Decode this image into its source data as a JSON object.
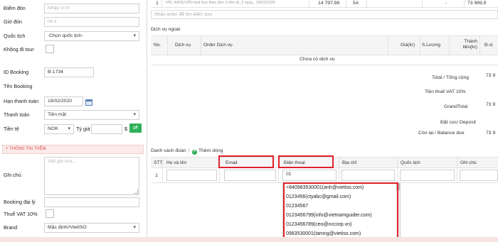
{
  "form": {
    "diem_don": {
      "label": "Điểm đón",
      "placeholder": "Nhập vị trí"
    },
    "gio_don": {
      "label": "Giờ đón",
      "placeholder": "hh:ii"
    },
    "quoc_tich": {
      "label": "Quốc tịch",
      "value": "-Chọn quốc tịch-"
    },
    "khong_di_tour": {
      "label": "Không đi tour"
    },
    "id_booking": {
      "label": "ID Booking",
      "value": "B-1734"
    },
    "ten_booking": {
      "label": "Tên Booking"
    },
    "han_thanh_toan": {
      "label": "Hạn thanh toán",
      "value": "19/02/2020"
    },
    "thanh_toan": {
      "label": "Thanh toán",
      "value": "Tiền mặt"
    },
    "tien_te": {
      "label": "Tiền tệ",
      "value": "NOK",
      "ty_gia_label": "Tỷ giá",
      "currency_symbol": "$"
    },
    "section_more": "+ THÔNG TIN THÊM",
    "ghi_chu": {
      "label": "Ghi chú",
      "placeholder": "Viết ghi chú..."
    },
    "booking_dai_ly": {
      "label": "Booking đại lý"
    },
    "thue_vat": {
      "label": "Thuế VAT 10%"
    },
    "brand": {
      "label": "Brand",
      "value": "Mặc định//VietISO"
    }
  },
  "tour_row": {
    "num": "1",
    "name": "VPL.RATE/VPD test tour theo đơn n tiền tệ_3 ngày_ 19/02/2020",
    "price": "14 797,98",
    "qty": "5A",
    "dash": "-",
    "total": "73 989,9"
  },
  "search_tour_placeholder": "Nhấn enter để tìm kiếm tour",
  "services": {
    "title": "Dịch vụ ngoài",
    "headers": [
      "No.",
      "Dịch vụ",
      "Order Dịch vụ",
      "Giá(kr)",
      "S.Lượng",
      "Thành tiền(kr)",
      "Đ.vị"
    ],
    "empty": "Chưa có dịch vụ"
  },
  "totals": [
    {
      "label": "Total / Tổng cộng",
      "value": "73 9"
    },
    {
      "label": "Tiền thuế VAT 10%",
      "value": ""
    },
    {
      "label": "GrandTotal",
      "value": "73 9"
    },
    {
      "label": "Đặt cọc/ Deposit",
      "value": ""
    },
    {
      "label": "Còn lại / Balance due",
      "value": "73 9"
    }
  ],
  "guests": {
    "title": "Danh sách đoàn",
    "add_label": "Thêm dòng",
    "headers": [
      "STT",
      "Họ và tên",
      "Email",
      "Điện thoại",
      "Địa chỉ",
      "Quốc tịch",
      "Ghi chú"
    ],
    "row_num": "1",
    "phone_value": "01"
  },
  "autocomplete": [
    "+840983530001(anh@vietiso.com)",
    "0123456(ctyabc@gmail.com)",
    "01234567",
    "0123456799(info@vietnamguider.com)",
    "0123456789(ceo@nccorp.vn)",
    "0983530001(tamng@vietiso.com)"
  ],
  "colors": {
    "highlight": "#e0202a",
    "green": "#2fb15a",
    "section": "#d9534f"
  }
}
